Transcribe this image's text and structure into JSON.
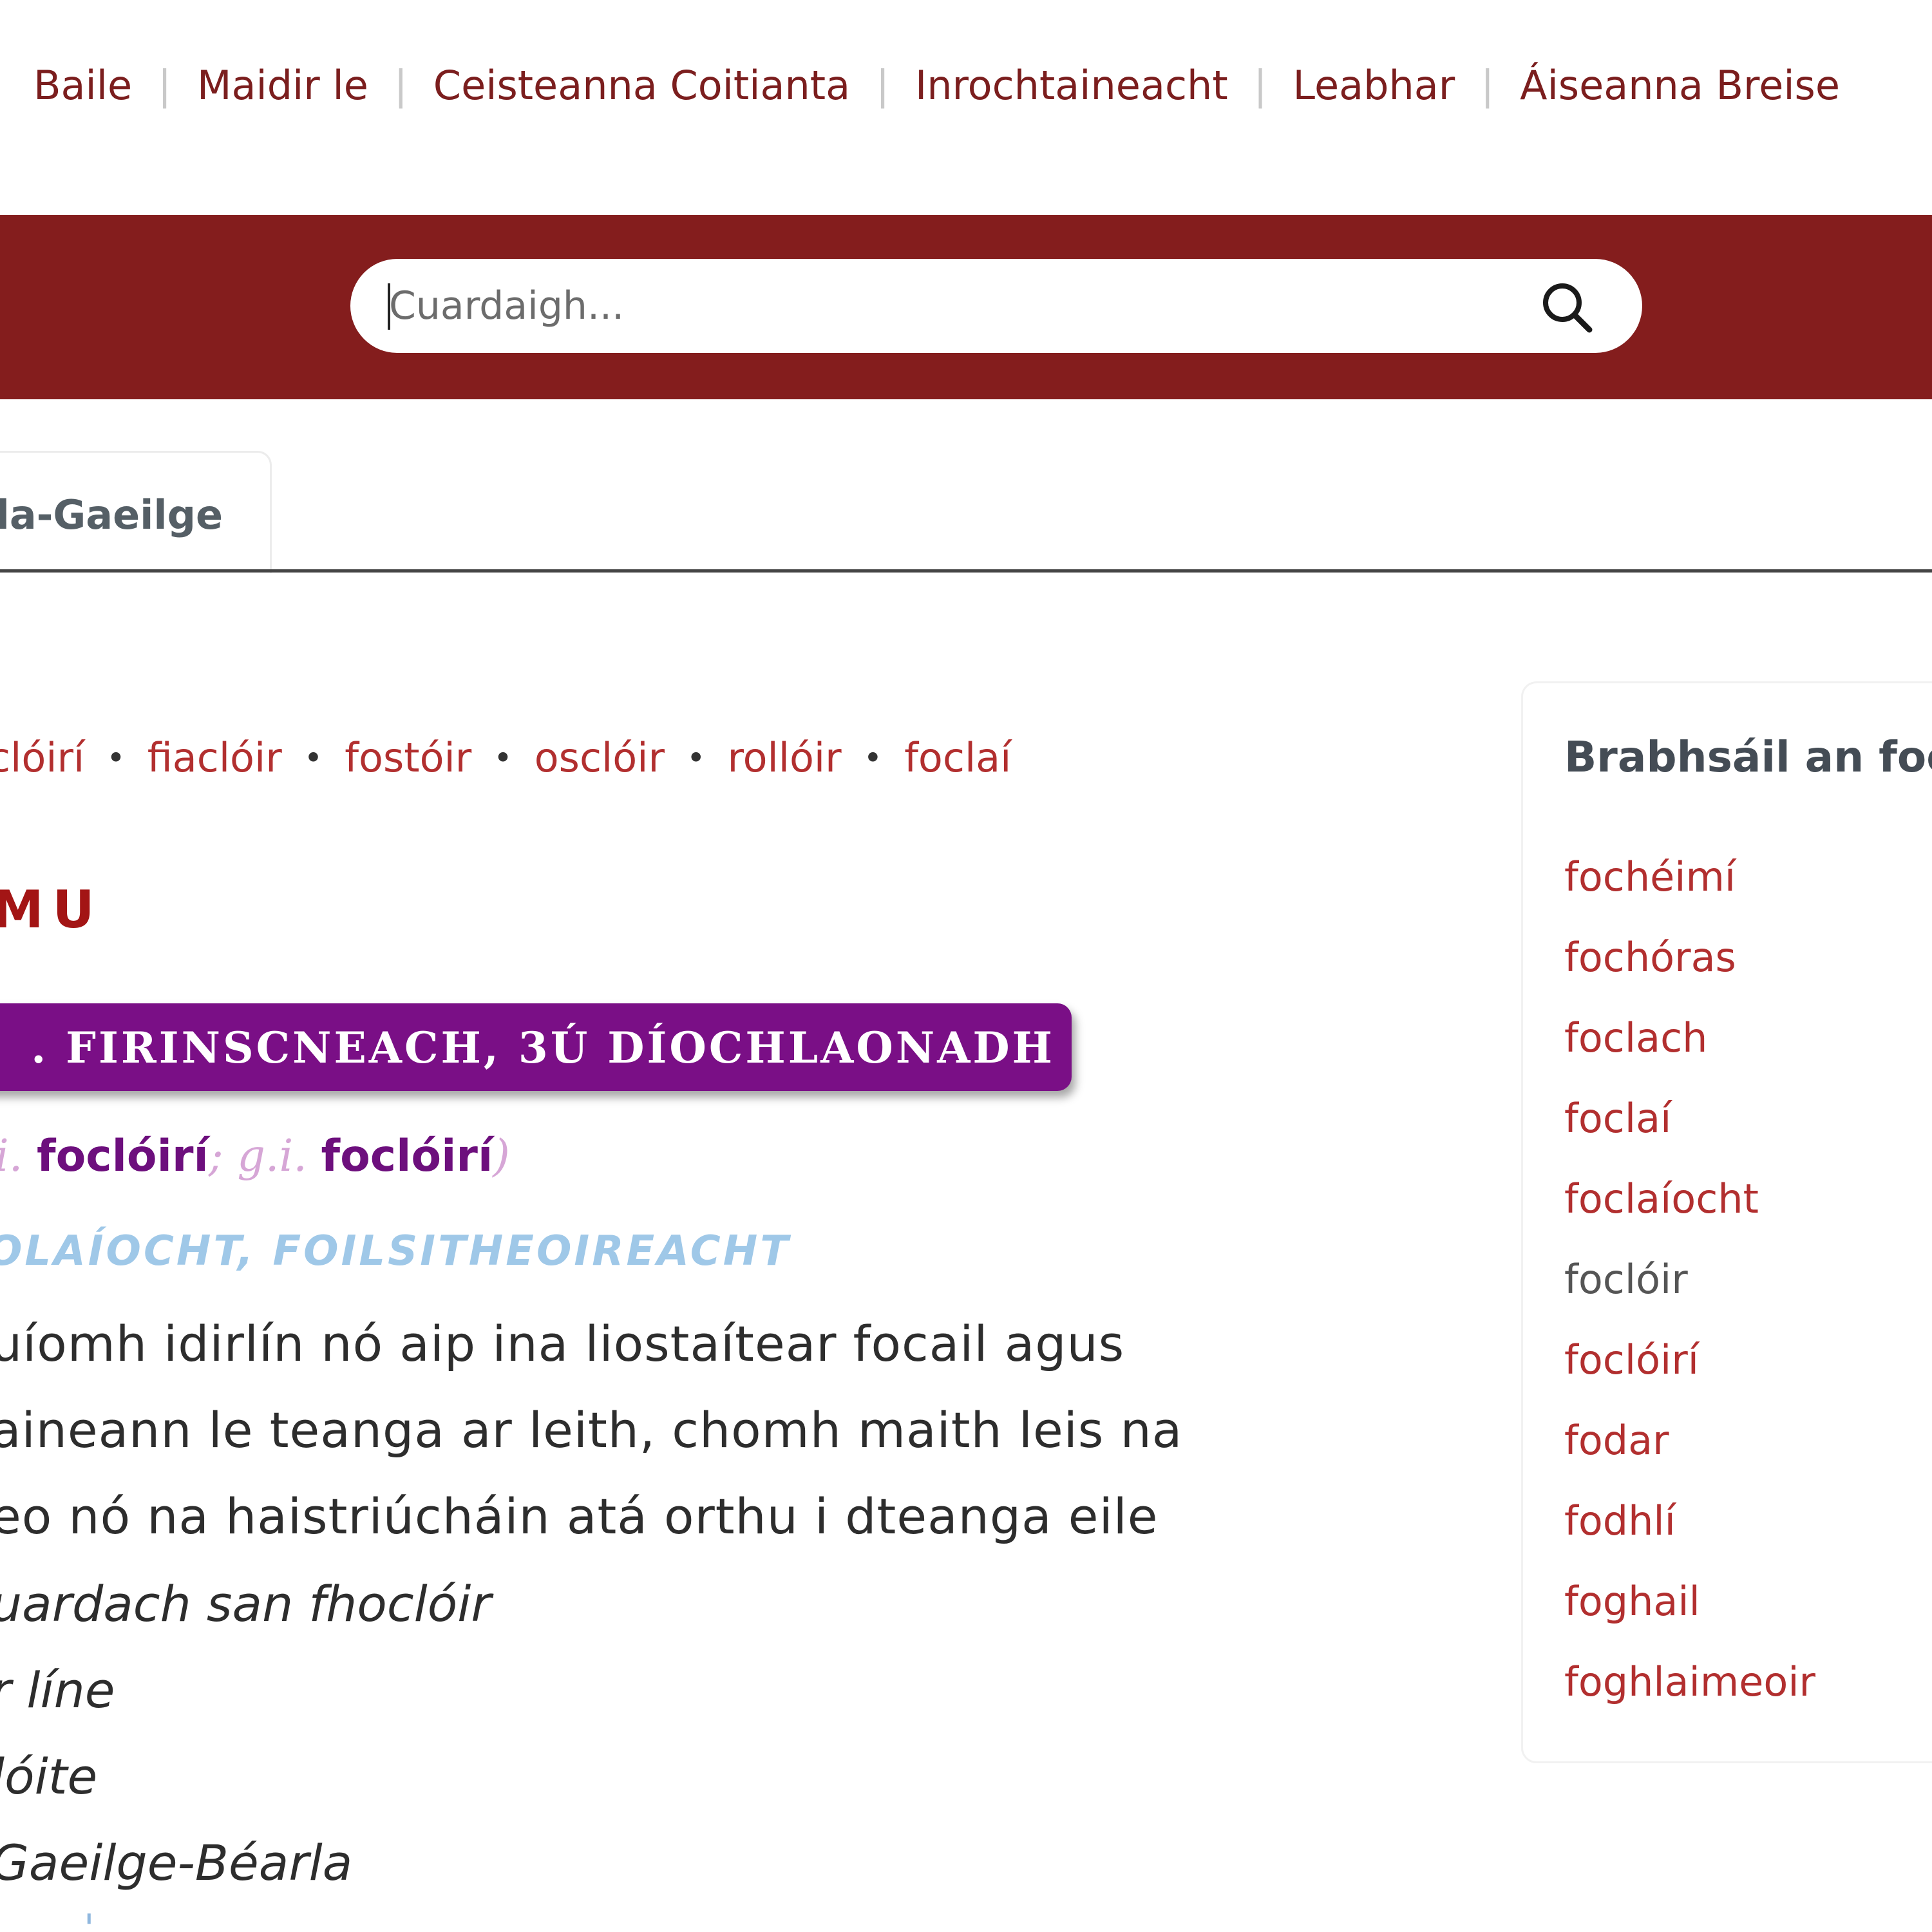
{
  "nav": {
    "items": [
      {
        "label": "Baile"
      },
      {
        "label": "Maidir le"
      },
      {
        "label": "Ceisteanna Coitianta"
      },
      {
        "label": "Inrochtaineacht"
      },
      {
        "label": "Leabhar"
      },
      {
        "label": "Áiseanna Breise"
      }
    ],
    "separator": "|"
  },
  "search": {
    "placeholder": "Cuardaigh..."
  },
  "tabs": {
    "active_label": "rla-Gaeilge"
  },
  "related_words": {
    "items": [
      "clóirí",
      "fiaclóir",
      "fostóir",
      "osclóir",
      "rollóir",
      "foclaí"
    ],
    "separator": "•"
  },
  "entry": {
    "headword": "MU",
    "grammar_badge": ". FIRINSCNEACH, 3Ú DÍOCHLAONADH",
    "forms": {
      "label1": "i.",
      "form1": "foclóirí",
      "sep": ";",
      "label2": "g.i.",
      "form2": "foclóirí",
      "close": ")"
    },
    "domain": "OLAÍOCHT, FOILSITHEOIREACHT",
    "definition_lines": [
      "uíomh idirlín nó aip ina liostaítear focail agus",
      "aineann le teanga ar leith, chomh maith leis na",
      "eo nó na haistriúcháin atá orthu i dteanga eile"
    ],
    "examples": [
      "uardach san fhoclóir",
      "r líne",
      "lóite",
      "Gaeilge-Béarla"
    ],
    "more_mark": "'"
  },
  "sidebar": {
    "title": "Brabhsáil an foc",
    "items": [
      {
        "label": "fochéimí"
      },
      {
        "label": "fochóras"
      },
      {
        "label": "foclach"
      },
      {
        "label": "foclaí"
      },
      {
        "label": "foclaíocht"
      },
      {
        "label": "foclóir",
        "current": true
      },
      {
        "label": "foclóirí"
      },
      {
        "label": "fodar"
      },
      {
        "label": "fodhlí"
      },
      {
        "label": "foghail"
      },
      {
        "label": "foghlaimeoir"
      }
    ]
  },
  "colors": {
    "brand_red": "#841d1d",
    "link_red": "#b22f2f",
    "badge_purple": "#7a0f86",
    "domain_blue": "#9fc8e8"
  },
  "icons": {
    "search": "search-icon"
  }
}
